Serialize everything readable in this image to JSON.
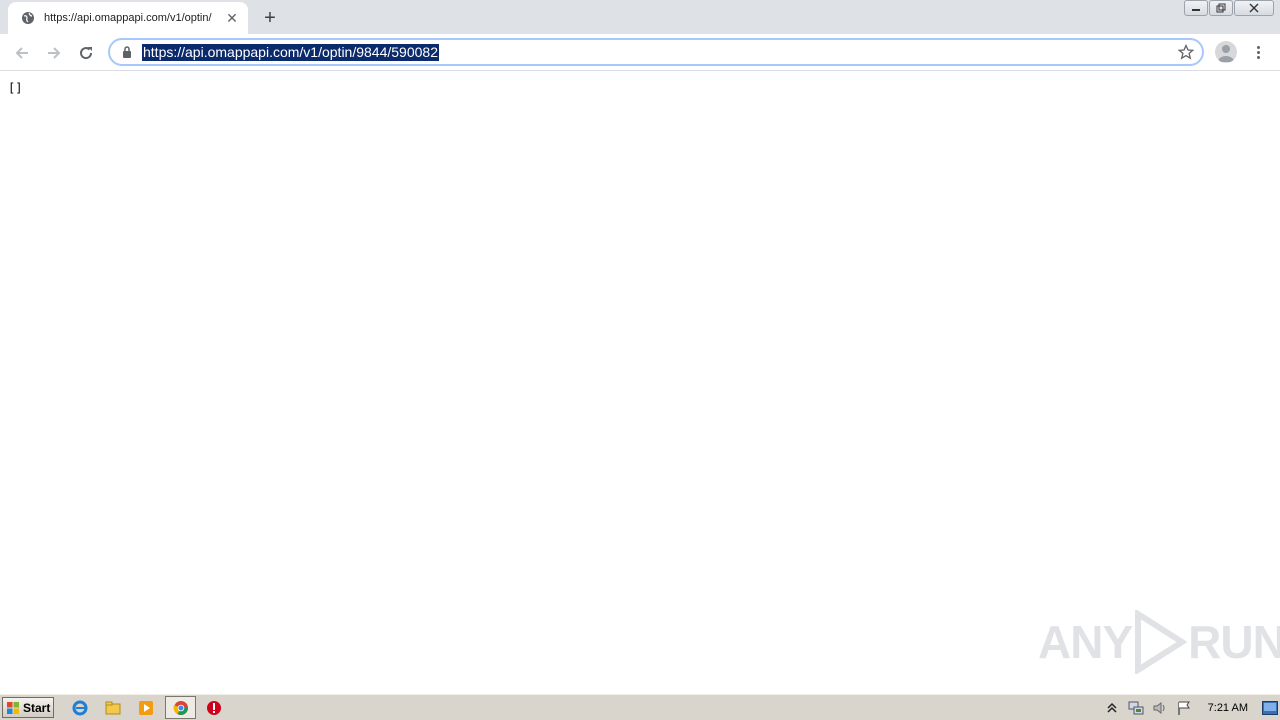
{
  "browser": {
    "tab": {
      "title": "https://api.omappapi.com/v1/optin/",
      "favicon": "globe-icon",
      "close_glyph": "✕"
    },
    "new_tab_glyph": "+",
    "window_controls": {
      "minimize": "▁",
      "restore": "❐",
      "close": "✕"
    },
    "toolbar": {
      "back": "arrow-left-icon",
      "forward": "arrow-right-icon",
      "reload": "reload-icon",
      "url": "https://api.omappapi.com/v1/optin/9844/590082",
      "url_selected": true
    }
  },
  "page": {
    "body_text": "[]"
  },
  "watermark": {
    "text_left": "ANY",
    "text_right": "RUN"
  },
  "taskbar": {
    "start_label": "Start",
    "pinned": [
      "internet-explorer-icon",
      "file-explorer-icon",
      "media-player-icon",
      "chrome-icon",
      "security-alert-icon"
    ],
    "clock": "7:21 AM"
  },
  "colors": {
    "selection_bg": "#0b2a6b",
    "omnibox_border": "#a8c7fa",
    "tabstrip_bg": "#dee1e6",
    "taskbar_bg": "#d9d5cc"
  }
}
